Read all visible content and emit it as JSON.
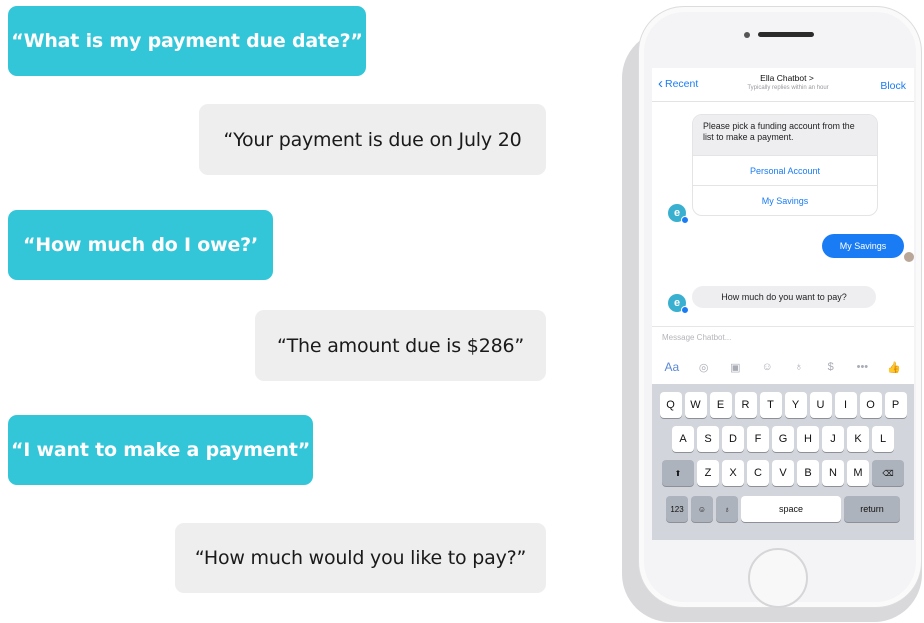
{
  "conversation": [
    {
      "speaker": "user",
      "text": "“What is my payment due date?”"
    },
    {
      "speaker": "bot",
      "text": "“Your payment is due on July 20"
    },
    {
      "speaker": "user",
      "text": "“How much do I owe?’"
    },
    {
      "speaker": "bot",
      "text": "“The amount due is $286”"
    },
    {
      "speaker": "user",
      "text": "“I want to make a payment”"
    },
    {
      "speaker": "bot",
      "text": "“How much would you like to pay?”"
    }
  ],
  "phone": {
    "header": {
      "back_label": "Recent",
      "title": "Ella Chatbot >",
      "subtitle": "Typically replies within an hour",
      "block_label": "Block"
    },
    "bot_initial": "e",
    "card": {
      "text": "Please pick a funding account from the list to make a payment.",
      "options": [
        "Personal Account",
        "My Savings"
      ]
    },
    "sent_message": "My Savings",
    "received_message": "How much do you want to pay?",
    "composer_placeholder": "Message Chatbot...",
    "tools": [
      {
        "icon": "text-format-icon",
        "glyph": "Aa"
      },
      {
        "icon": "camera-icon",
        "glyph": "◎"
      },
      {
        "icon": "gif-icon",
        "glyph": "▣"
      },
      {
        "icon": "emoji-icon",
        "glyph": "☺"
      },
      {
        "icon": "microphone-icon",
        "glyph": "♁"
      },
      {
        "icon": "payment-icon",
        "glyph": "$"
      },
      {
        "icon": "more-icon",
        "glyph": "•••"
      },
      {
        "icon": "like-icon",
        "glyph": "👍"
      }
    ],
    "keyboard": {
      "row1": [
        "Q",
        "W",
        "E",
        "R",
        "T",
        "Y",
        "U",
        "I",
        "O",
        "P"
      ],
      "row2": [
        "A",
        "S",
        "D",
        "F",
        "G",
        "H",
        "J",
        "K",
        "L"
      ],
      "row3": [
        "Z",
        "X",
        "C",
        "V",
        "B",
        "N",
        "M"
      ],
      "shift_glyph": "⬆",
      "backspace_glyph": "⌫",
      "numbers_label": "123",
      "emoji_glyph": "☺",
      "mic_glyph": "♁",
      "space_label": "space",
      "return_label": "return"
    }
  },
  "colors": {
    "user_bubble": "#33c6d9",
    "bot_bubble": "#eeeeef",
    "messenger_blue": "#1a7cf5"
  }
}
